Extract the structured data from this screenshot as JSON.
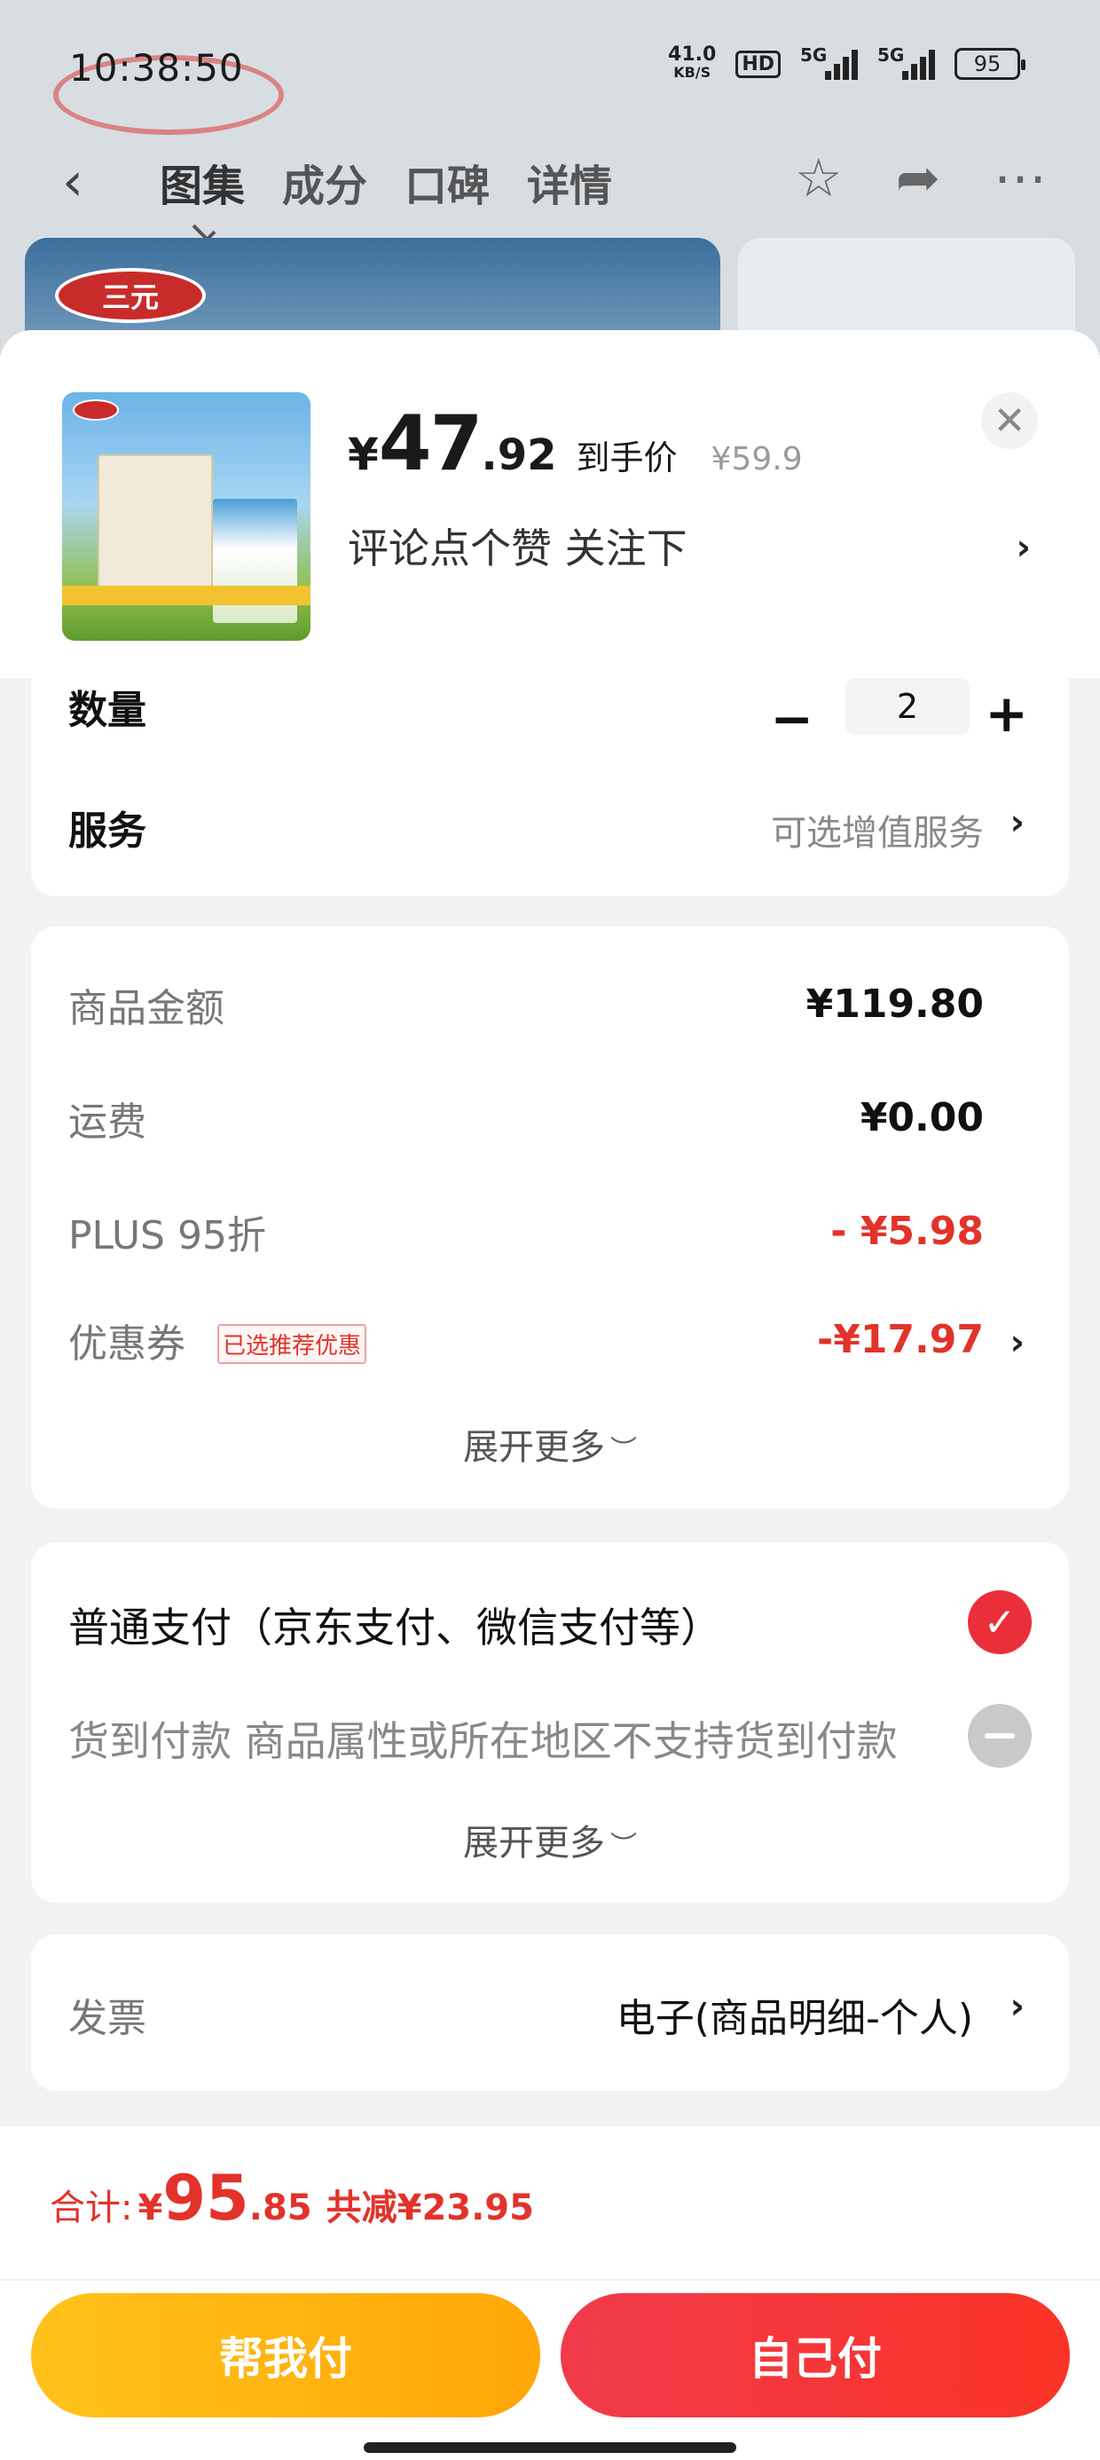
{
  "status_bar": {
    "time": "10:38:50",
    "net_speed_value": "41.0",
    "net_speed_unit": "KB/S",
    "hd_label": "HD",
    "signal1_label": "5G",
    "signal2_label": "5G",
    "battery": "95"
  },
  "nav": {
    "back_icon": "back-arrow-icon",
    "tabs": [
      "图集",
      "成分",
      "口碑",
      "详情"
    ],
    "active_tab": 0,
    "actions": [
      "star-icon",
      "share-icon",
      "more-icon"
    ],
    "brand_logo": "三元"
  },
  "product": {
    "price_currency": "¥",
    "price_int": "47",
    "price_dec": ".92",
    "price_label": "到手价",
    "original_price": "¥59.9",
    "follow_text": "评论点个赞  关注下"
  },
  "quantity": {
    "label": "数量",
    "value": "2"
  },
  "service": {
    "label": "服务",
    "value": "可选增值服务"
  },
  "amounts": {
    "rows": [
      {
        "label": "商品金额",
        "value": "¥119.80"
      },
      {
        "label": "运费",
        "value": "¥0.00"
      },
      {
        "label": "PLUS 95折",
        "value": "- ¥5.98"
      },
      {
        "label": "优惠券",
        "value": "-¥17.97",
        "tag": "已选推荐优惠"
      }
    ],
    "expand_label": "展开更多"
  },
  "payment": {
    "option1": "普通支付（京东支付、微信支付等）",
    "option2": "货到付款 商品属性或所在地区不支持货到付款",
    "expand_label": "展开更多"
  },
  "invoice": {
    "label": "发票",
    "value": "电子(商品明细-个人)"
  },
  "footer": {
    "total_label": "合计:",
    "total_currency": "¥",
    "total_int": "95",
    "total_dec": ".85",
    "total_saved": "共减¥23.95",
    "help_pay_label": "帮我付",
    "self_pay_label": "自己付"
  },
  "colors": {
    "accent_red": "#e3322a",
    "check_red": "#ea2e3a",
    "help_yellow": "#ffb30f",
    "self_red": "#f5343a"
  }
}
